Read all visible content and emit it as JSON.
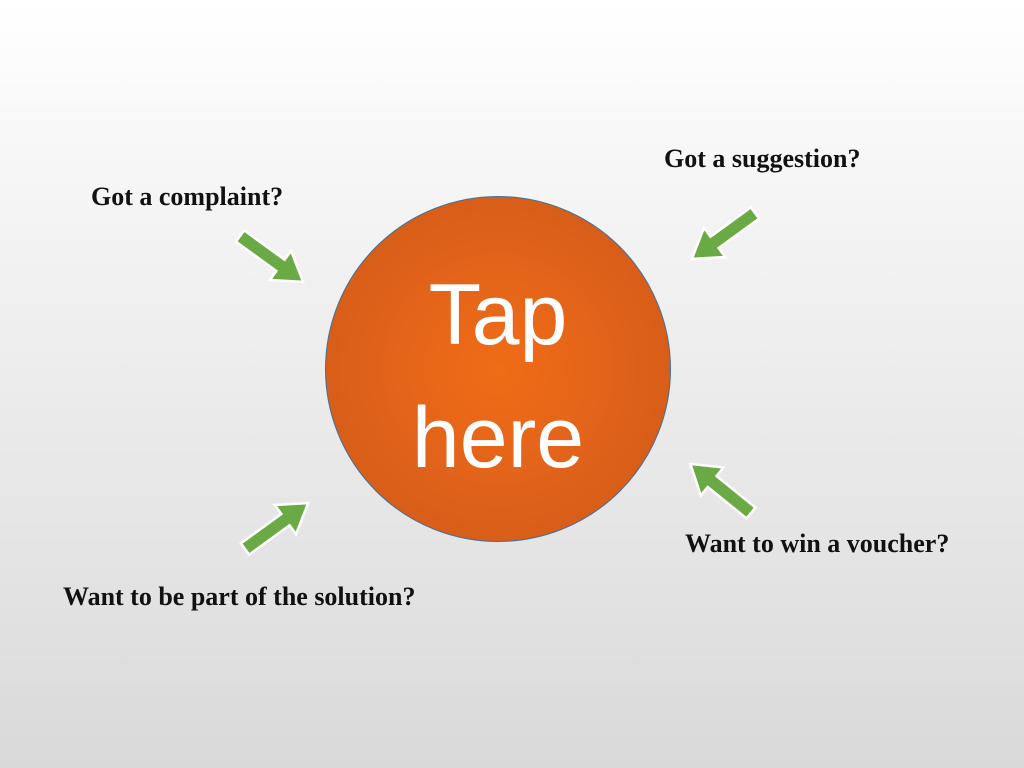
{
  "prompts": {
    "complaint": "Got a complaint?",
    "suggestion": "Got a suggestion?",
    "solution": "Want to be part of the solution?",
    "voucher": "Want to win a voucher?"
  },
  "tap_button": {
    "line1": "Tap",
    "line2": "here"
  },
  "colors": {
    "button_fill": "#e2631a",
    "button_border": "#41719c",
    "button_text": "#ffffff",
    "arrow_fill": "#6aaa45",
    "arrow_stroke": "#ffffff",
    "prompt_text": "#111111"
  },
  "icons": {
    "arrow": "arrow-pointing-to-center-icon"
  }
}
